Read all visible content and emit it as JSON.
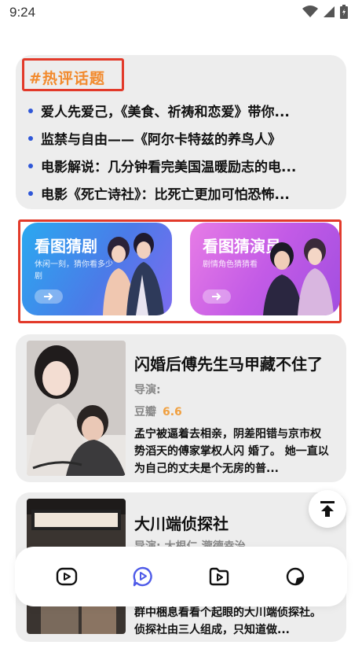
{
  "status_bar": {
    "time": "9:24"
  },
  "hot_topics": {
    "tag": "#热评话题",
    "items": [
      "爱人先爱己，《美食、祈祷和恋爱》带你...",
      "监禁与自由——《阿尔卡特兹的养鸟人》",
      "电影解说：几分钟看完美国温暖励志的电...",
      "电影《死亡诗社》：比死亡更加可怕恐怖..."
    ]
  },
  "banners": [
    {
      "title": "看图猜剧",
      "subtitle": "休闲一刻，猜你看多少剧"
    },
    {
      "title": "看图猜演员",
      "subtitle": "剧情角色猜猜看"
    }
  ],
  "movies": [
    {
      "title": "闪婚后傅先生马甲藏不住了",
      "director_label": "导演:",
      "score_label": "豆瓣",
      "score": "6.6",
      "description": "孟宁被逼着去相亲，阴差阳错与京市权势滔天的傅家掌权人闪 婚了。 她一直以为自己的丈夫是个无房的普..."
    },
    {
      "title": "大川端侦探社",
      "director_label": "导演: 大根仁,瀧德幸治",
      "description": "群中梱息看看个起眼的大川端侦探社。侦探社由三人组成，只知道做..."
    }
  ],
  "colors": {
    "accent_red": "#e23a2a",
    "tag_orange": "#f28a2d",
    "dot_blue": "#2f57d8",
    "score_orange": "#f0a040",
    "nav_active": "#4e5ae8"
  },
  "bottom_nav": [
    {
      "icon": "play-icon"
    },
    {
      "icon": "chat-play-icon"
    },
    {
      "icon": "folder-play-icon"
    },
    {
      "icon": "circle-icon"
    }
  ]
}
